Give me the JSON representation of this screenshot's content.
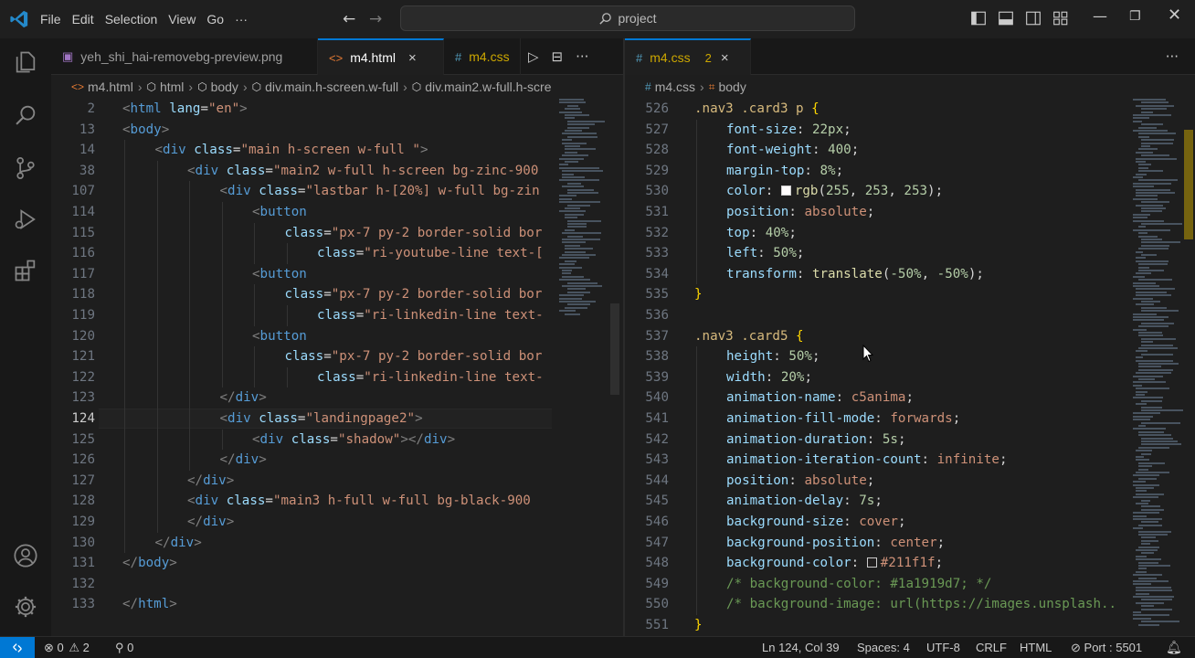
{
  "menu": {
    "items": [
      "File",
      "Edit",
      "Selection",
      "View",
      "Go"
    ],
    "more": "···"
  },
  "search": {
    "placeholder": "project"
  },
  "left_group": {
    "tabs": [
      {
        "label": "yeh_shi_hai-removebg-preview.png",
        "icon": "image-icon",
        "active": false
      },
      {
        "label": "m4.html",
        "icon": "html-icon",
        "active": true,
        "close": "×"
      },
      {
        "label": "m4.css",
        "icon": "css-icon",
        "active": false
      }
    ],
    "actions": {
      "run": "▷",
      "split": "⊟",
      "more": "···"
    },
    "breadcrumb": [
      "m4.html",
      "html",
      "body",
      "div.main.h-screen.w-full",
      "div.main2.w-full.h-scre"
    ],
    "lines": [
      {
        "n": "2",
        "indent": 1,
        "tokens": [
          [
            "t-ang",
            "<"
          ],
          [
            "t-tag",
            "html"
          ],
          [
            "t-attr",
            " lang"
          ],
          [
            "t-punc",
            "="
          ],
          [
            "t-str",
            "\"en\""
          ],
          [
            "t-ang",
            ">"
          ]
        ]
      },
      {
        "n": "13",
        "indent": 1,
        "tokens": [
          [
            "t-ang",
            "<"
          ],
          [
            "t-tag",
            "body"
          ],
          [
            "t-ang",
            ">"
          ]
        ]
      },
      {
        "n": "14",
        "indent": 2,
        "tokens": [
          [
            "t-ang",
            "<"
          ],
          [
            "t-tag",
            "div"
          ],
          [
            "t-attr",
            " class"
          ],
          [
            "t-punc",
            "="
          ],
          [
            "t-str",
            "\"main h-screen w-full \""
          ],
          [
            "t-ang",
            ">"
          ]
        ]
      },
      {
        "n": "38",
        "indent": 3,
        "tokens": [
          [
            "t-ang",
            "<"
          ],
          [
            "t-tag",
            "div"
          ],
          [
            "t-attr",
            " class"
          ],
          [
            "t-punc",
            "="
          ],
          [
            "t-str",
            "\"main2 w-full h-screen bg-zinc-900"
          ]
        ]
      },
      {
        "n": "107",
        "indent": 4,
        "tokens": [
          [
            "t-ang",
            "<"
          ],
          [
            "t-tag",
            "div"
          ],
          [
            "t-attr",
            " class"
          ],
          [
            "t-punc",
            "="
          ],
          [
            "t-str",
            "\"lastbar h-[20%] w-full bg-zin"
          ]
        ]
      },
      {
        "n": "114",
        "indent": 5,
        "tokens": [
          [
            "t-ang",
            "<"
          ],
          [
            "t-tag",
            "button"
          ]
        ]
      },
      {
        "n": "115",
        "indent": 6,
        "tokens": [
          [
            "t-attr",
            "class"
          ],
          [
            "t-punc",
            "="
          ],
          [
            "t-str",
            "\"px-7 py-2 border-solid bor"
          ]
        ]
      },
      {
        "n": "116",
        "indent": 7,
        "tokens": [
          [
            "t-attr",
            "class"
          ],
          [
            "t-punc",
            "="
          ],
          [
            "t-str",
            "\"ri-youtube-line text-["
          ]
        ]
      },
      {
        "n": "117",
        "indent": 5,
        "tokens": [
          [
            "t-ang",
            "<"
          ],
          [
            "t-tag",
            "button"
          ]
        ]
      },
      {
        "n": "118",
        "indent": 6,
        "tokens": [
          [
            "t-attr",
            "class"
          ],
          [
            "t-punc",
            "="
          ],
          [
            "t-str",
            "\"px-7 py-2 border-solid bor"
          ]
        ]
      },
      {
        "n": "119",
        "indent": 7,
        "tokens": [
          [
            "t-attr",
            "class"
          ],
          [
            "t-punc",
            "="
          ],
          [
            "t-str",
            "\"ri-linkedin-line text-"
          ]
        ]
      },
      {
        "n": "120",
        "indent": 5,
        "tokens": [
          [
            "t-ang",
            "<"
          ],
          [
            "t-tag",
            "button"
          ]
        ]
      },
      {
        "n": "121",
        "indent": 6,
        "tokens": [
          [
            "t-attr",
            "class"
          ],
          [
            "t-punc",
            "="
          ],
          [
            "t-str",
            "\"px-7 py-2 border-solid bor"
          ]
        ]
      },
      {
        "n": "122",
        "indent": 7,
        "tokens": [
          [
            "t-attr",
            "class"
          ],
          [
            "t-punc",
            "="
          ],
          [
            "t-str",
            "\"ri-linkedin-line text-"
          ]
        ]
      },
      {
        "n": "123",
        "indent": 4,
        "tokens": [
          [
            "t-ang",
            "</"
          ],
          [
            "t-tag",
            "div"
          ],
          [
            "t-ang",
            ">"
          ]
        ]
      },
      {
        "n": "124",
        "indent": 4,
        "current": true,
        "tokens": [
          [
            "t-ang",
            "<"
          ],
          [
            "t-tag",
            "div"
          ],
          [
            "t-attr",
            " class"
          ],
          [
            "t-punc",
            "="
          ],
          [
            "t-str",
            "\"landingpage2\""
          ],
          [
            "t-ang",
            ">"
          ]
        ]
      },
      {
        "n": "125",
        "indent": 5,
        "tokens": [
          [
            "t-ang",
            "<"
          ],
          [
            "t-tag",
            "div"
          ],
          [
            "t-attr",
            " class"
          ],
          [
            "t-punc",
            "="
          ],
          [
            "t-str",
            "\"shadow\""
          ],
          [
            "t-ang",
            "></"
          ],
          [
            "t-tag",
            "div"
          ],
          [
            "t-ang",
            ">"
          ]
        ]
      },
      {
        "n": "126",
        "indent": 4,
        "tokens": [
          [
            "t-ang",
            "</"
          ],
          [
            "t-tag",
            "div"
          ],
          [
            "t-ang",
            ">"
          ]
        ]
      },
      {
        "n": "127",
        "indent": 3,
        "tokens": [
          [
            "t-ang",
            "</"
          ],
          [
            "t-tag",
            "div"
          ],
          [
            "t-ang",
            ">"
          ]
        ]
      },
      {
        "n": "128",
        "indent": 3,
        "tokens": [
          [
            "t-ang",
            "<"
          ],
          [
            "t-tag",
            "div"
          ],
          [
            "t-attr",
            " class"
          ],
          [
            "t-punc",
            "="
          ],
          [
            "t-str",
            "\"main3 h-full w-full bg-black-900 "
          ]
        ]
      },
      {
        "n": "129",
        "indent": 3,
        "tokens": [
          [
            "t-ang",
            "</"
          ],
          [
            "t-tag",
            "div"
          ],
          [
            "t-ang",
            ">"
          ]
        ]
      },
      {
        "n": "130",
        "indent": 2,
        "tokens": [
          [
            "t-ang",
            "</"
          ],
          [
            "t-tag",
            "div"
          ],
          [
            "t-ang",
            ">"
          ]
        ]
      },
      {
        "n": "131",
        "indent": 1,
        "tokens": [
          [
            "t-ang",
            "</"
          ],
          [
            "t-tag",
            "body"
          ],
          [
            "t-ang",
            ">"
          ]
        ]
      },
      {
        "n": "132",
        "indent": 1,
        "tokens": []
      },
      {
        "n": "133",
        "indent": 1,
        "tokens": [
          [
            "t-ang",
            "</"
          ],
          [
            "t-tag",
            "html"
          ],
          [
            "t-ang",
            ">"
          ]
        ]
      }
    ]
  },
  "right_group": {
    "tabs": [
      {
        "label": "m4.css",
        "icon": "css-icon",
        "active": true,
        "badge": "2",
        "close": "×"
      }
    ],
    "actions": {
      "more": "···"
    },
    "breadcrumb": [
      "m4.css",
      "body"
    ],
    "lines": [
      {
        "n": "526",
        "indent": 1,
        "tokens": [
          [
            "t-sel",
            ".nav3 .card3 p "
          ],
          [
            "t-brace",
            "{"
          ]
        ]
      },
      {
        "n": "527",
        "indent": 2,
        "tokens": [
          [
            "t-prop",
            "font-size"
          ],
          [
            "t-punc",
            ": "
          ],
          [
            "t-num",
            "22px"
          ],
          [
            "t-punc",
            ";"
          ]
        ]
      },
      {
        "n": "528",
        "indent": 2,
        "tokens": [
          [
            "t-prop",
            "font-weight"
          ],
          [
            "t-punc",
            ": "
          ],
          [
            "t-num",
            "400"
          ],
          [
            "t-punc",
            ";"
          ]
        ]
      },
      {
        "n": "529",
        "indent": 2,
        "tokens": [
          [
            "t-prop",
            "margin-top"
          ],
          [
            "t-punc",
            ": "
          ],
          [
            "t-num",
            "8%"
          ],
          [
            "t-punc",
            ";"
          ]
        ]
      },
      {
        "n": "530",
        "indent": 2,
        "swatch": "#fffdfd",
        "tokens": [
          [
            "t-prop",
            "color"
          ],
          [
            "t-punc",
            ": "
          ],
          [
            "swatch",
            ""
          ],
          [
            "t-fn",
            "rgb"
          ],
          [
            "t-punc",
            "("
          ],
          [
            "t-num",
            "255"
          ],
          [
            "t-punc",
            ", "
          ],
          [
            "t-num",
            "253"
          ],
          [
            "t-punc",
            ", "
          ],
          [
            "t-num",
            "253"
          ],
          [
            "t-punc",
            ");"
          ]
        ]
      },
      {
        "n": "531",
        "indent": 2,
        "tokens": [
          [
            "t-prop",
            "position"
          ],
          [
            "t-punc",
            ": "
          ],
          [
            "t-val",
            "absolute"
          ],
          [
            "t-punc",
            ";"
          ]
        ]
      },
      {
        "n": "532",
        "indent": 2,
        "tokens": [
          [
            "t-prop",
            "top"
          ],
          [
            "t-punc",
            ": "
          ],
          [
            "t-num",
            "40%"
          ],
          [
            "t-punc",
            ";"
          ]
        ]
      },
      {
        "n": "533",
        "indent": 2,
        "tokens": [
          [
            "t-prop",
            "left"
          ],
          [
            "t-punc",
            ": "
          ],
          [
            "t-num",
            "50%"
          ],
          [
            "t-punc",
            ";"
          ]
        ]
      },
      {
        "n": "534",
        "indent": 2,
        "tokens": [
          [
            "t-prop",
            "transform"
          ],
          [
            "t-punc",
            ": "
          ],
          [
            "t-fn",
            "translate"
          ],
          [
            "t-punc",
            "("
          ],
          [
            "t-num",
            "-50%"
          ],
          [
            "t-punc",
            ", "
          ],
          [
            "t-num",
            "-50%"
          ],
          [
            "t-punc",
            ");"
          ]
        ]
      },
      {
        "n": "535",
        "indent": 1,
        "tokens": [
          [
            "t-brace",
            "}"
          ]
        ]
      },
      {
        "n": "536",
        "indent": 1,
        "tokens": []
      },
      {
        "n": "537",
        "indent": 1,
        "tokens": [
          [
            "t-sel",
            ".nav3 .card5 "
          ],
          [
            "t-brace",
            "{"
          ]
        ]
      },
      {
        "n": "538",
        "indent": 2,
        "tokens": [
          [
            "t-prop",
            "height"
          ],
          [
            "t-punc",
            ": "
          ],
          [
            "t-num",
            "50%"
          ],
          [
            "t-punc",
            ";"
          ]
        ]
      },
      {
        "n": "539",
        "indent": 2,
        "tokens": [
          [
            "t-prop",
            "width"
          ],
          [
            "t-punc",
            ": "
          ],
          [
            "t-num",
            "20%"
          ],
          [
            "t-punc",
            ";"
          ]
        ]
      },
      {
        "n": "540",
        "indent": 2,
        "tokens": [
          [
            "t-prop",
            "animation-name"
          ],
          [
            "t-punc",
            ": "
          ],
          [
            "t-val",
            "c5anima"
          ],
          [
            "t-punc",
            ";"
          ]
        ]
      },
      {
        "n": "541",
        "indent": 2,
        "tokens": [
          [
            "t-prop",
            "animation-fill-mode"
          ],
          [
            "t-punc",
            ": "
          ],
          [
            "t-val",
            "forwards"
          ],
          [
            "t-punc",
            ";"
          ]
        ]
      },
      {
        "n": "542",
        "indent": 2,
        "tokens": [
          [
            "t-prop",
            "animation-duration"
          ],
          [
            "t-punc",
            ": "
          ],
          [
            "t-num",
            "5s"
          ],
          [
            "t-punc",
            ";"
          ]
        ]
      },
      {
        "n": "543",
        "indent": 2,
        "tokens": [
          [
            "t-prop",
            "animation-iteration-count"
          ],
          [
            "t-punc",
            ": "
          ],
          [
            "t-val",
            "infinite"
          ],
          [
            "t-punc",
            ";"
          ]
        ]
      },
      {
        "n": "544",
        "indent": 2,
        "tokens": [
          [
            "t-prop",
            "position"
          ],
          [
            "t-punc",
            ": "
          ],
          [
            "t-val",
            "absolute"
          ],
          [
            "t-punc",
            ";"
          ]
        ]
      },
      {
        "n": "545",
        "indent": 2,
        "tokens": [
          [
            "t-prop",
            "animation-delay"
          ],
          [
            "t-punc",
            ": "
          ],
          [
            "t-num",
            "7s"
          ],
          [
            "t-punc",
            ";"
          ]
        ]
      },
      {
        "n": "546",
        "indent": 2,
        "tokens": [
          [
            "t-prop",
            "background-size"
          ],
          [
            "t-punc",
            ": "
          ],
          [
            "t-val",
            "cover"
          ],
          [
            "t-punc",
            ";"
          ]
        ]
      },
      {
        "n": "547",
        "indent": 2,
        "tokens": [
          [
            "t-prop",
            "background-position"
          ],
          [
            "t-punc",
            ": "
          ],
          [
            "t-val",
            "center"
          ],
          [
            "t-punc",
            ";"
          ]
        ]
      },
      {
        "n": "548",
        "indent": 2,
        "swatch": "#211f1f",
        "tokens": [
          [
            "t-prop",
            "background-color"
          ],
          [
            "t-punc",
            ": "
          ],
          [
            "swatch",
            ""
          ],
          [
            "t-val",
            "#211f1f"
          ],
          [
            "t-punc",
            ";"
          ]
        ]
      },
      {
        "n": "549",
        "indent": 2,
        "tokens": [
          [
            "t-com",
            "/* background-color: #1a1919d7; */"
          ]
        ]
      },
      {
        "n": "550",
        "indent": 2,
        "tokens": [
          [
            "t-com",
            "/* background-image: url(https://images.unsplash.."
          ]
        ]
      },
      {
        "n": "551",
        "indent": 1,
        "tokens": [
          [
            "t-brace",
            "}"
          ]
        ]
      }
    ]
  },
  "statusbar": {
    "errors": "0",
    "warnings": "2",
    "ports_count": "0",
    "cursor": "Ln 124, Col 39",
    "spaces": "Spaces: 4",
    "encoding": "UTF-8",
    "eol": "CRLF",
    "language": "HTML",
    "port": "Port : 5501"
  },
  "colors": {
    "accent": "#0078d4",
    "background": "#1e1e1e",
    "titlebar": "#1f1f1f",
    "activitybar": "#181818"
  }
}
